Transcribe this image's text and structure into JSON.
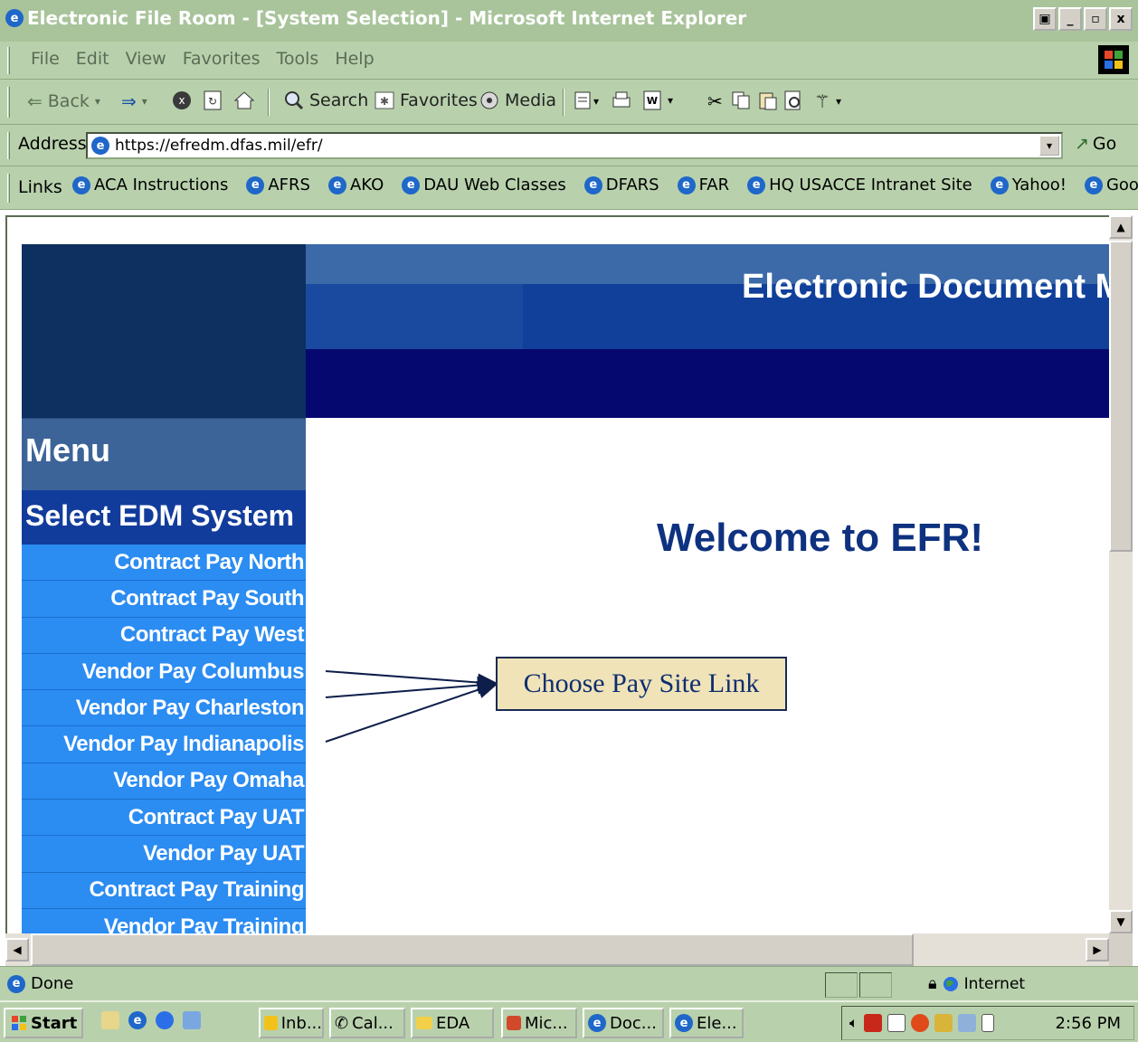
{
  "window": {
    "title": "Electronic File Room - [System Selection] - Microsoft Internet Explorer",
    "controls": [
      "▫▣",
      "_",
      "▫",
      "x"
    ]
  },
  "menubar": {
    "items": [
      "File",
      "Edit",
      "View",
      "Favorites",
      "Tools",
      "Help"
    ]
  },
  "toolbar": {
    "back": "Back",
    "search": "Search",
    "favorites": "Favorites",
    "media": "Media"
  },
  "address": {
    "label": "Address",
    "url": "https://efredm.dfas.mil/efr/",
    "go": "Go"
  },
  "links": {
    "label": "Links",
    "items": [
      "ACA Instructions",
      "AFRS",
      "AKO",
      "DAU Web Classes",
      "DFARS",
      "FAR",
      "HQ USACCE Intranet Site",
      "Yahoo!",
      "Google"
    ]
  },
  "page": {
    "banner_title": "Electronic Document M",
    "menu_title": "Menu",
    "select_title": "Select EDM System",
    "welcome": "Welcome to EFR!",
    "menu_items": [
      "Contract Pay North",
      "Contract Pay South",
      "Contract Pay West",
      "Vendor Pay Columbus",
      "Vendor Pay Charleston",
      "Vendor Pay Indianapolis",
      "Vendor Pay Omaha",
      "Contract Pay UAT",
      "Vendor Pay UAT",
      "Contract Pay Training",
      "Vendor Pay Training"
    ],
    "callout": "Choose Pay Site Link"
  },
  "status": {
    "text": "Done",
    "zone": "Internet"
  },
  "taskbar": {
    "start": "Start",
    "tasks": [
      "Inb...",
      "Cal...",
      "EDA",
      "Mic...",
      "Doc...",
      "Ele..."
    ],
    "time": "2:56 PM"
  },
  "colors": {
    "chrome": "#b8d1ac",
    "banner_dark": "#05086e",
    "menu_item_blue": "#2b8cf2",
    "welcome_text": "#0e3280",
    "callout_bg": "#f0e3b8"
  }
}
